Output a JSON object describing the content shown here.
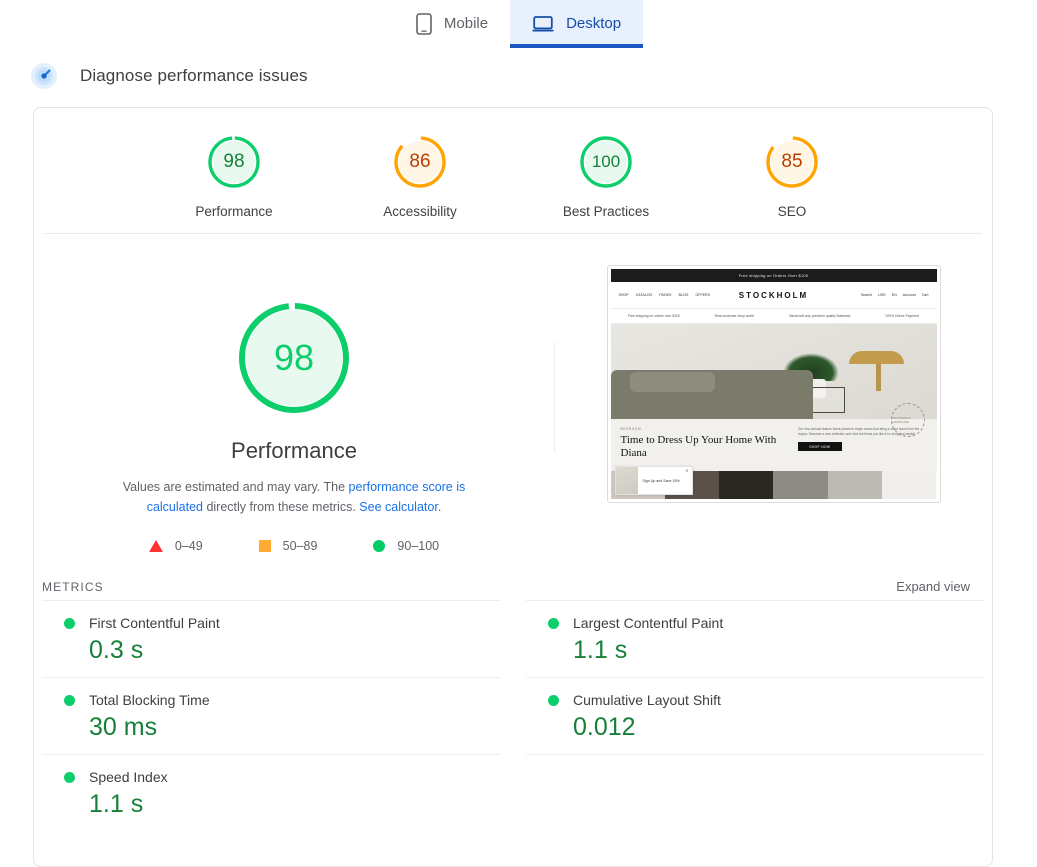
{
  "tabs": [
    {
      "id": "mobile",
      "label": "Mobile",
      "icon": "mobile-phone-icon",
      "active": false
    },
    {
      "id": "desktop",
      "label": "Desktop",
      "icon": "laptop-icon",
      "active": true
    }
  ],
  "header": {
    "title": "Diagnose performance issues",
    "icon": "diagnose-icon"
  },
  "category_scores": [
    {
      "label": "Performance",
      "value": 98,
      "color": "#0cce6b",
      "fill": "#e8f9ef",
      "text_color": "#178038"
    },
    {
      "label": "Accessibility",
      "value": 86,
      "color": "#ffa400",
      "fill": "#fff6e5",
      "text_color": "#b93d00"
    },
    {
      "label": "Best Practices",
      "value": 100,
      "color": "#0cce6b",
      "fill": "#e8f9ef",
      "text_color": "#178038"
    },
    {
      "label": "SEO",
      "value": 85,
      "color": "#ffa400",
      "fill": "#fff6e5",
      "text_color": "#b93d00"
    }
  ],
  "summary": {
    "score": 98,
    "label": "Performance",
    "ring_color": "#0cce6b",
    "fill_color": "#e8f9ef",
    "text_color": "#0cce6b",
    "disclaimer_prefix": "Values are estimated and may vary. The ",
    "disclaimer_link1": "performance score is calculated",
    "disclaimer_mid": " directly from these metrics. ",
    "disclaimer_link2": "See calculator",
    "disclaimer_suffix": "."
  },
  "legend": [
    {
      "shape": "triangle",
      "range": "0–49",
      "color": "#ff3333"
    },
    {
      "shape": "square",
      "range": "50–89",
      "color": "#ffaa33"
    },
    {
      "shape": "circle",
      "range": "90–100",
      "color": "#00cc66"
    }
  ],
  "metrics_section": {
    "title": "METRICS",
    "expand_label": "Expand view"
  },
  "metrics": [
    {
      "name": "First Contentful Paint",
      "value": "0.3 s",
      "status": "good"
    },
    {
      "name": "Largest Contentful Paint",
      "value": "1.1 s",
      "status": "good"
    },
    {
      "name": "Total Blocking Time",
      "value": "30 ms",
      "status": "good"
    },
    {
      "name": "Cumulative Layout Shift",
      "value": "0.012",
      "status": "good"
    },
    {
      "name": "Speed Index",
      "value": "1.1 s",
      "status": "good"
    }
  ],
  "screenshot": {
    "alt": "page-screenshot-thumbnail",
    "announce_bar": "Free shipping on Orders Over $100",
    "brand": "STOCKHOLM",
    "nav_links": [
      "SHOP",
      "CATALOG",
      "PAGES",
      "BLOG",
      "OFFERS"
    ],
    "nav_actions": [
      "Search",
      "USD",
      "EN",
      "Account",
      "Cart"
    ],
    "trust_badges": [
      "Free shipping on orders over $100",
      "Real customer story worth",
      "Handcraft only premium quality Materials",
      "100% Online Payment"
    ],
    "hero_eyebrow": "BEDROOM",
    "hero_heading": "Time to Dress Up Your Home With Diana",
    "hero_paragraph": "Our new arrivals feature those pieces to begin rooms that bring a warm leave from the tropics. Discover a new collection and click the items you like it for shopping basket.",
    "hero_button": "SHOP NOW",
    "seal_text": "STOCKHOLM FURNITURE",
    "popup_text": "Sign Up and Save 15%",
    "popup_close": "✕"
  }
}
